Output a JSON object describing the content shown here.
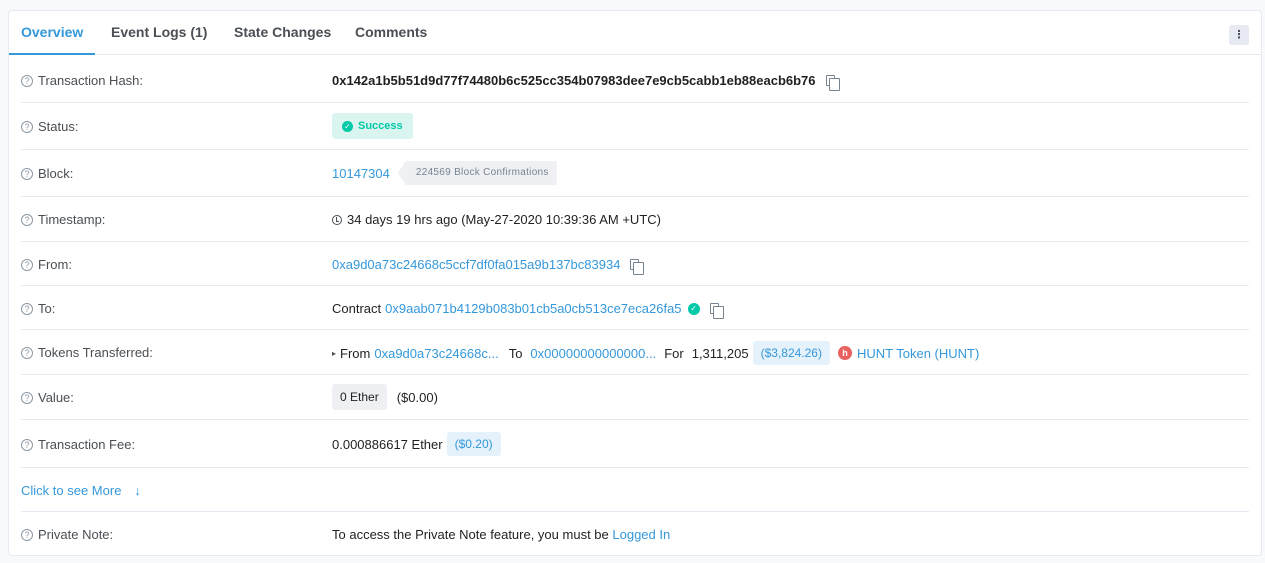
{
  "tabs": [
    {
      "label": "Overview"
    },
    {
      "label": "Event Logs (1)"
    },
    {
      "label": "State Changes"
    },
    {
      "label": "Comments"
    }
  ],
  "menu_icon": "⋮",
  "rows": {
    "tx_hash": {
      "label": "Transaction Hash:",
      "value": "0x142a1b5b51d9d77f74480b6c525cc354b07983dee7e9cb5cabb1eb88eacb6b76"
    },
    "status": {
      "label": "Status:",
      "value": "Success"
    },
    "block": {
      "label": "Block:",
      "number": "10147304",
      "confirmations": "224569 Block Confirmations"
    },
    "timestamp": {
      "label": "Timestamp:",
      "value": "34 days 19 hrs ago (May-27-2020 10:39:36 AM +UTC)"
    },
    "from": {
      "label": "From:",
      "value": "0xa9d0a73c24668c5ccf7df0fa015a9b137bc83934"
    },
    "to": {
      "label": "To:",
      "prefix": "Contract",
      "value": "0x9aab071b4129b083b01cb5a0cb513ce7eca26fa5"
    },
    "tokens": {
      "label": "Tokens Transferred:",
      "from_label": "From",
      "from": "0xa9d0a73c24668c...",
      "to_label": "To",
      "to": "0x00000000000000...",
      "for_label": "For",
      "amount": "1,311,205",
      "usd": "($3,824.26)",
      "token_icon_letter": "h",
      "token_name": "HUNT Token (HUNT)"
    },
    "value": {
      "label": "Value:",
      "amount": "0 Ether",
      "usd": "($0.00)"
    },
    "fee": {
      "label": "Transaction Fee:",
      "amount": "0.000886617 Ether",
      "usd": "($0.20)"
    },
    "see_more": {
      "label": "Click to see More",
      "arrow": "↓"
    },
    "private_note": {
      "label": "Private Note:",
      "text": "To access the Private Note feature, you must be ",
      "link": "Logged In"
    }
  },
  "colors": {
    "accent": "#3498db",
    "success": "#00c9a7",
    "token": "#e8625f"
  }
}
